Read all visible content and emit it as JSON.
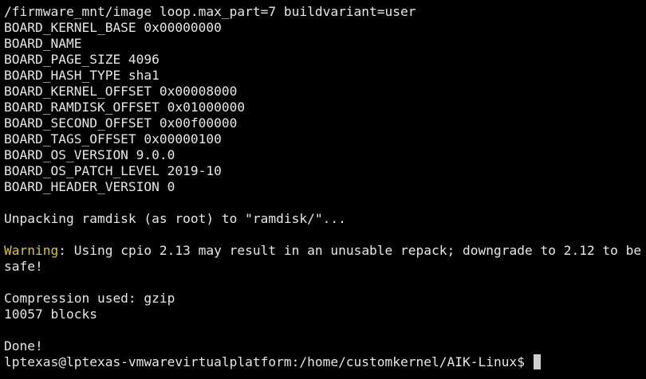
{
  "terminal": {
    "lines": [
      "/firmware_mnt/image loop.max_part=7 buildvariant=user",
      "BOARD_KERNEL_BASE 0x00000000",
      "BOARD_NAME",
      "BOARD_PAGE_SIZE 4096",
      "BOARD_HASH_TYPE sha1",
      "BOARD_KERNEL_OFFSET 0x00008000",
      "BOARD_RAMDISK_OFFSET 0x01000000",
      "BOARD_SECOND_OFFSET 0x00f00000",
      "BOARD_TAGS_OFFSET 0x00000100",
      "BOARD_OS_VERSION 9.0.0",
      "BOARD_OS_PATCH_LEVEL 2019-10",
      "BOARD_HEADER_VERSION 0"
    ],
    "unpacking": "Unpacking ramdisk (as root) to \"ramdisk/\"...",
    "warning_label": "Warning",
    "warning_text": ": Using cpio 2.13 may result in an unusable repack; downgrade to 2.12 to be safe!",
    "compression": "Compression used: gzip",
    "blocks": "10057 blocks",
    "done": "Done!",
    "prompt": "lptexas@lptexas-vmwarevirtualplatform:/home/customkernel/AIK-Linux$ "
  },
  "colors": {
    "background": "#000000",
    "foreground": "#e6e6e6",
    "warning": "#d7c23a",
    "cursor": "#d0d0d0"
  }
}
